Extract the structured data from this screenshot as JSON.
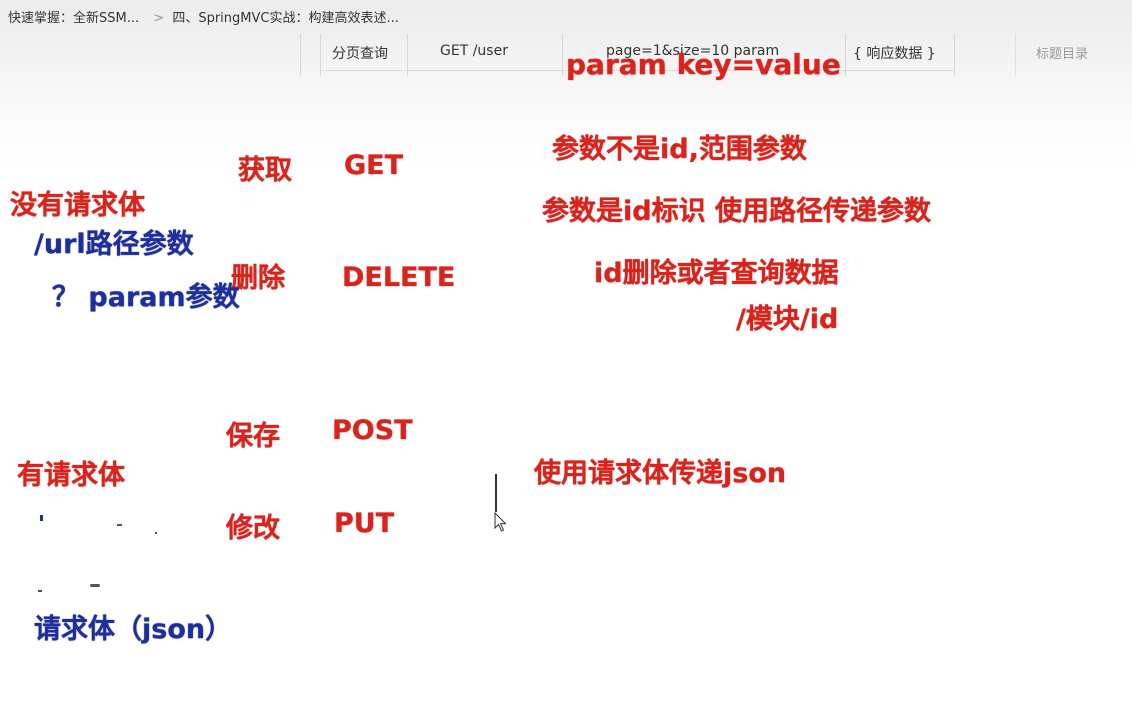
{
  "breadcrumb": {
    "item1": "快速掌握：全新SSM...",
    "separator": ">",
    "item2": "四、SpringMVC实战：构建高效表述..."
  },
  "doc_table": {
    "cell1": "分页查询",
    "cell2": "GET  /user",
    "cell3": "page=1&size=10 param",
    "cell4": "{ 响应数据 }"
  },
  "toc": {
    "label": "标题目录"
  },
  "notes": {
    "param_kv": "param   key=value",
    "get_cn": "获取",
    "get_en": "GET",
    "delete_cn": "删除",
    "delete_en": "DELETE",
    "post_cn": "保存",
    "post_en": "POST",
    "put_cn": "修改",
    "put_en": "PUT",
    "no_body": "没有请求体",
    "url_path": "/url路径参数",
    "q_param": "？ param参数",
    "has_body": "有请求体",
    "body_json": "请求体（json）",
    "range_param": "参数不是id,范围参数",
    "id_path": "参数是id标识    使用路径传递参数",
    "id_delete_query": "id删除或者查询数据",
    "module_id": "/模块/id",
    "use_body_json": "使用请求体传递json"
  },
  "colors": {
    "annotation_red": "#d8241c",
    "annotation_blue": "#1d2f9e"
  },
  "icons": {
    "mouse": "mouse-pointer-icon"
  }
}
